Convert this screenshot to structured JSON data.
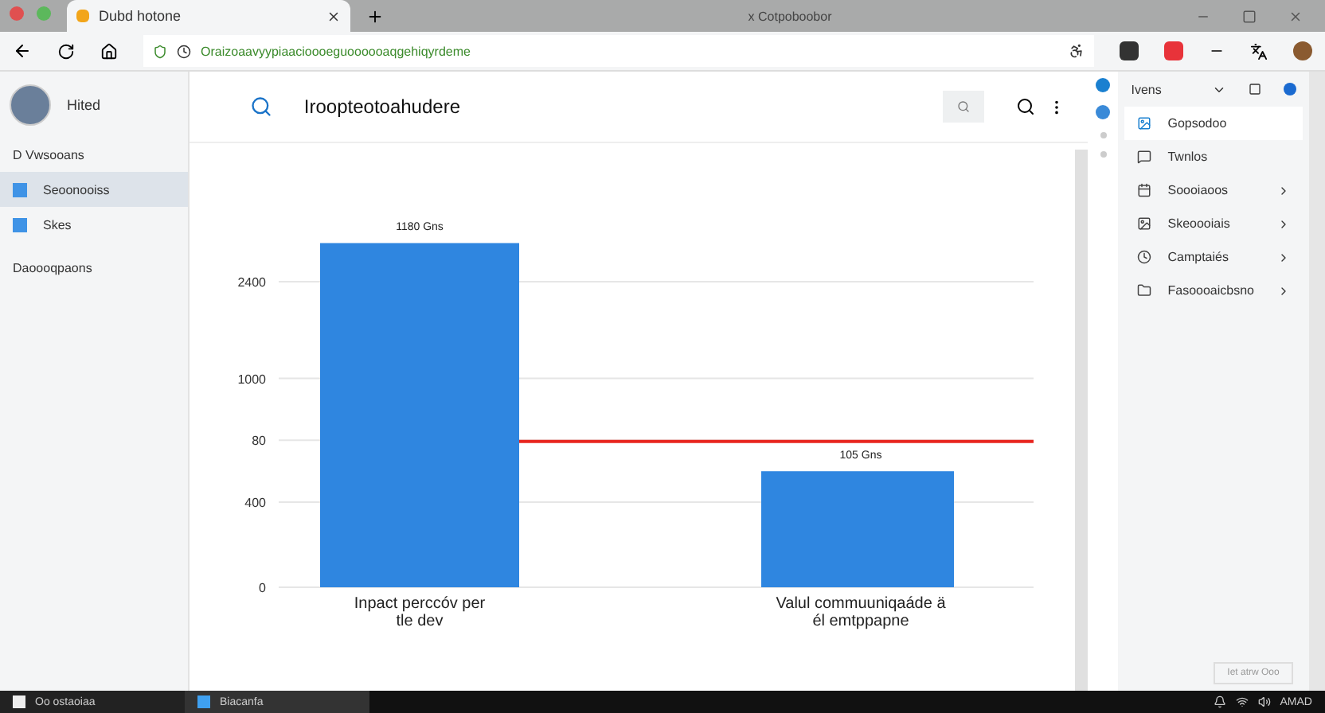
{
  "window": {
    "tab_title": "Dubd hotone",
    "title": "x Cotpoboobor"
  },
  "address_bar": {
    "url": "Oraizoaavyypiaacioooeguoooooaqgehiqyrdeme"
  },
  "profile": {
    "name": "Hited"
  },
  "sidebar": {
    "heading": "D Vwsooans",
    "items": [
      {
        "label": "Seoonooiss",
        "selected": true
      },
      {
        "label": "Skes",
        "selected": false
      }
    ],
    "footer": "Daoooqpaons"
  },
  "search": {
    "value": "Iroopteotoahudere"
  },
  "chart": {
    "y_axis_labels": [
      "2400",
      "1000",
      "80",
      "400",
      "0"
    ],
    "bars": [
      {
        "category": "Inpact perccóv per\ntle dev",
        "value_label": "1180 Gns"
      },
      {
        "category": "Valul commuuniqaáde ä\nél emtppapne",
        "value_label": "105 Gns"
      }
    ]
  },
  "side_panel": {
    "title": "Ivens",
    "items": [
      {
        "label": "Gopsodoo",
        "selected": true,
        "arrow": false
      },
      {
        "label": "Twnlos",
        "selected": false,
        "arrow": false
      },
      {
        "label": "Soooiaoos",
        "selected": false,
        "arrow": true
      },
      {
        "label": "Skeoooiais",
        "selected": false,
        "arrow": true
      },
      {
        "label": "Camptaiés",
        "selected": false,
        "arrow": true
      },
      {
        "label": "Fasoooaicbsno",
        "selected": false,
        "arrow": true
      }
    ],
    "footer_button": "Iet atrw Ooo"
  },
  "taskbar": {
    "items": [
      {
        "label": "Oo ostaoiaa",
        "selected": false
      },
      {
        "label": "Biacanfa",
        "selected": true
      }
    ],
    "clock": "AMAD"
  }
}
